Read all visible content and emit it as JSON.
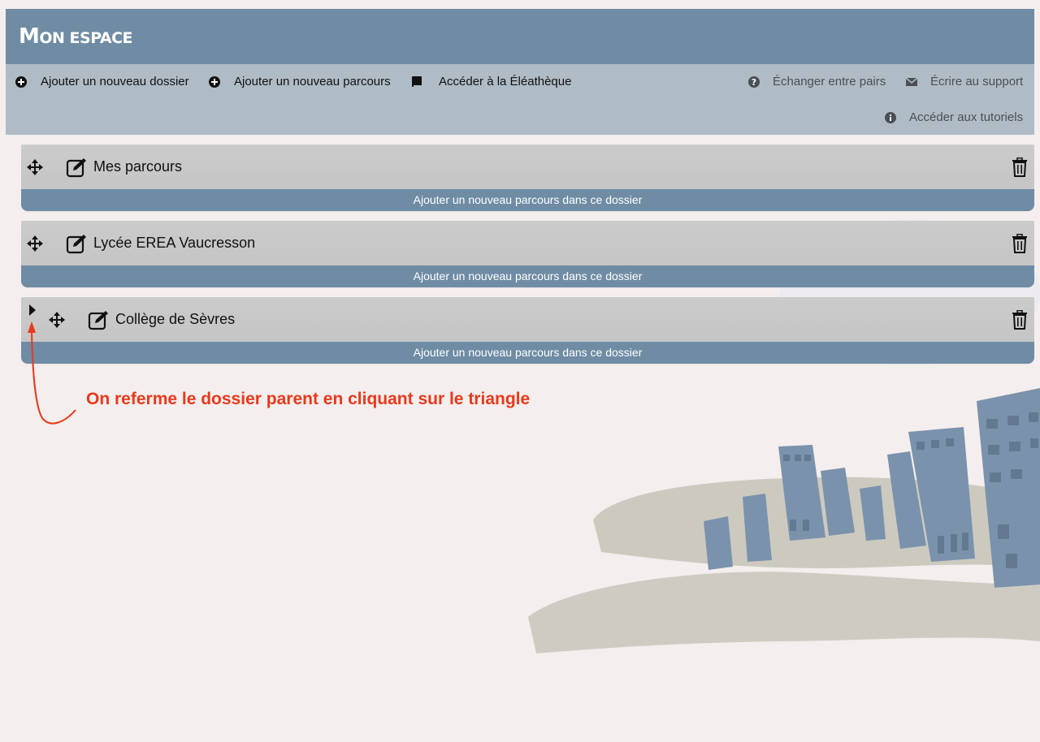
{
  "header": {
    "title_first": "M",
    "title_rest": "on espace"
  },
  "toolbar": {
    "left": [
      {
        "label": "Ajouter un nouveau dossier",
        "icon": "plus-circle-icon"
      },
      {
        "label": "Ajouter un nouveau parcours",
        "icon": "plus-circle-icon"
      },
      {
        "label": "Accéder à la Éléathèque",
        "icon": "book-icon"
      }
    ],
    "right": [
      {
        "label": "Échanger entre pairs",
        "icon": "question-circle-icon"
      },
      {
        "label": "Écrire au support",
        "icon": "envelope-icon"
      },
      {
        "label": "Accéder aux tutoriels",
        "icon": "info-circle-icon"
      }
    ]
  },
  "folders": [
    {
      "title": "Mes parcours",
      "add_label": "Ajouter un nouveau parcours dans ce dossier"
    },
    {
      "title": "Lycée EREA Vaucresson",
      "add_label": "Ajouter un nouveau parcours dans ce dossier"
    },
    {
      "title": "Collège de Sèvres",
      "add_label": "Ajouter un nouveau parcours dans ce dossier"
    }
  ],
  "annotation": {
    "text": "On referme le dossier parent en cliquant sur le triangle"
  },
  "colors": {
    "header_bg": "#6f8ca4",
    "toolbar_bg": "#afbcc6",
    "folder_bg": "#c9c9c9",
    "annotation": "#e8391b",
    "page_bg": "#f4eeee"
  }
}
